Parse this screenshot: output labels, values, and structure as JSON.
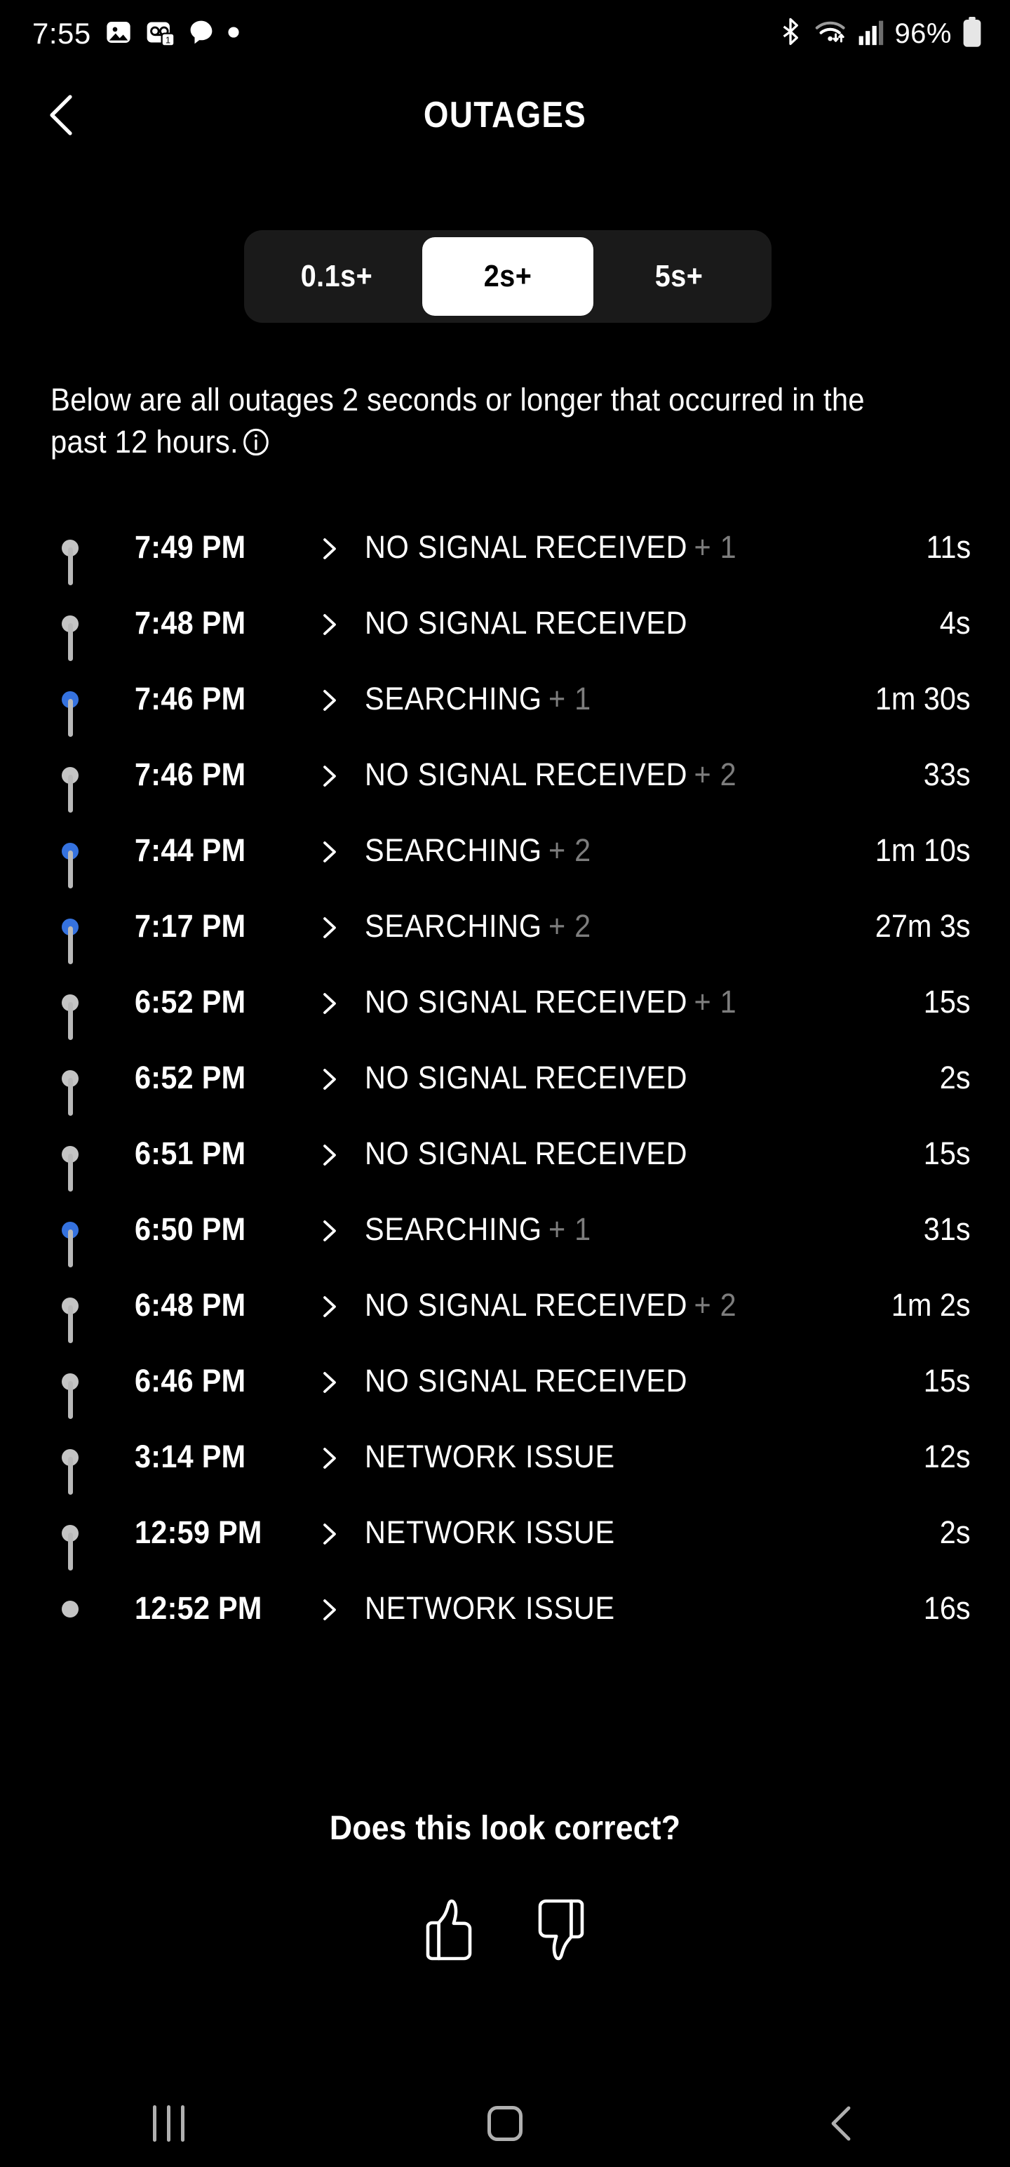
{
  "status_bar": {
    "time": "7:55",
    "battery_percent": "96%",
    "left_icons": [
      "image-icon",
      "voicemail-badge-icon",
      "chat-bubble-icon",
      "dot-indicator-icon"
    ],
    "right_icons": [
      "bluetooth-icon",
      "wifi-icon",
      "cellular-signal-icon",
      "battery-icon"
    ]
  },
  "app_bar": {
    "back_icon": "back-chevron-icon",
    "title": "OUTAGES"
  },
  "filter": {
    "options": [
      {
        "label": "0.1s+",
        "selected": false
      },
      {
        "label": "2s+",
        "selected": true
      },
      {
        "label": "5s+",
        "selected": false
      }
    ],
    "selected": "2s+"
  },
  "description": {
    "text": "Below are all outages 2 seconds or longer that occurred in the past 12 hours.",
    "info_icon": "info-icon"
  },
  "colors": {
    "background": "#000000",
    "segment_track": "#1a1a1a",
    "dot_gray": "#c4c4c4",
    "dot_blue": "#3572df",
    "muted_text": "#7d7d7d",
    "timeline_line": "#b9b9b9"
  },
  "outages": [
    {
      "time": "7:49 PM",
      "label": "NO SIGNAL RECEIVED",
      "extra": "+ 1",
      "duration": "11s",
      "dot": "gray"
    },
    {
      "time": "7:48 PM",
      "label": "NO SIGNAL RECEIVED",
      "extra": "",
      "duration": "4s",
      "dot": "gray"
    },
    {
      "time": "7:46 PM",
      "label": "SEARCHING",
      "extra": "+ 1",
      "duration": "1m 30s",
      "dot": "blue"
    },
    {
      "time": "7:46 PM",
      "label": "NO SIGNAL RECEIVED",
      "extra": "+ 2",
      "duration": "33s",
      "dot": "gray"
    },
    {
      "time": "7:44 PM",
      "label": "SEARCHING",
      "extra": "+ 2",
      "duration": "1m 10s",
      "dot": "blue"
    },
    {
      "time": "7:17 PM",
      "label": "SEARCHING",
      "extra": "+ 2",
      "duration": "27m 3s",
      "dot": "blue"
    },
    {
      "time": "6:52 PM",
      "label": "NO SIGNAL RECEIVED",
      "extra": "+ 1",
      "duration": "15s",
      "dot": "gray"
    },
    {
      "time": "6:52 PM",
      "label": "NO SIGNAL RECEIVED",
      "extra": "",
      "duration": "2s",
      "dot": "gray"
    },
    {
      "time": "6:51 PM",
      "label": "NO SIGNAL RECEIVED",
      "extra": "",
      "duration": "15s",
      "dot": "gray"
    },
    {
      "time": "6:50 PM",
      "label": "SEARCHING",
      "extra": "+ 1",
      "duration": "31s",
      "dot": "blue"
    },
    {
      "time": "6:48 PM",
      "label": "NO SIGNAL RECEIVED",
      "extra": "+ 2",
      "duration": "1m 2s",
      "dot": "gray"
    },
    {
      "time": "6:46 PM",
      "label": "NO SIGNAL RECEIVED",
      "extra": "",
      "duration": "15s",
      "dot": "gray"
    },
    {
      "time": "3:14 PM",
      "label": "NETWORK ISSUE",
      "extra": "",
      "duration": "12s",
      "dot": "gray"
    },
    {
      "time": "12:59 PM",
      "label": "NETWORK ISSUE",
      "extra": "",
      "duration": "2s",
      "dot": "gray"
    },
    {
      "time": "12:52 PM",
      "label": "NETWORK ISSUE",
      "extra": "",
      "duration": "16s",
      "dot": "gray"
    }
  ],
  "feedback": {
    "question": "Does this look correct?",
    "thumbs_up_icon": "thumbs-up-icon",
    "thumbs_down_icon": "thumbs-down-icon"
  },
  "nav_bar": {
    "recents_icon": "recents-icon",
    "home_icon": "home-icon",
    "back_icon": "nav-back-icon"
  }
}
